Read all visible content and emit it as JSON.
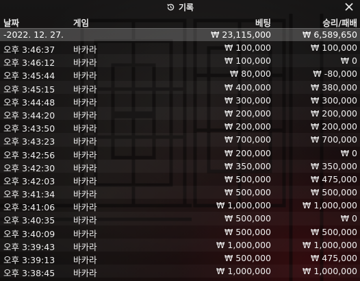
{
  "window": {
    "title": "기록",
    "icons": {
      "history": "clock-history-icon",
      "close": "close-icon"
    }
  },
  "columns": {
    "date": "날짜",
    "game": "게임",
    "bet": "베팅",
    "result": "승리/패배"
  },
  "summary": {
    "date": "-2022. 12. 27.",
    "game": "",
    "bet": "₩ 23,115,000",
    "result": "₩ 6,589,650"
  },
  "rows": [
    {
      "time": "오후 3:46:37",
      "game": "바카라",
      "bet": "₩ 100,000",
      "result": "₩ 100,000"
    },
    {
      "time": "오후 3:46:12",
      "game": "바카라",
      "bet": "₩ 100,000",
      "result": "₩ 0"
    },
    {
      "time": "오후 3:45:44",
      "game": "바카라",
      "bet": "₩ 80,000",
      "result": "₩ -80,000"
    },
    {
      "time": "오후 3:45:15",
      "game": "바카라",
      "bet": "₩ 400,000",
      "result": "₩ 380,000"
    },
    {
      "time": "오후 3:44:48",
      "game": "바카라",
      "bet": "₩ 300,000",
      "result": "₩ 300,000"
    },
    {
      "time": "오후 3:44:20",
      "game": "바카라",
      "bet": "₩ 200,000",
      "result": "₩ 200,000"
    },
    {
      "time": "오후 3:43:50",
      "game": "바카라",
      "bet": "₩ 200,000",
      "result": "₩ 200,000"
    },
    {
      "time": "오후 3:43:23",
      "game": "바카라",
      "bet": "₩ 700,000",
      "result": "₩ 700,000"
    },
    {
      "time": "오후 3:42:56",
      "game": "바카라",
      "bet": "₩ 200,000",
      "result": "₩ 0"
    },
    {
      "time": "오후 3:42:30",
      "game": "바카라",
      "bet": "₩ 350,000",
      "result": "₩ 350,000"
    },
    {
      "time": "오후 3:42:03",
      "game": "바카라",
      "bet": "₩ 500,000",
      "result": "₩ 475,000"
    },
    {
      "time": "오후 3:41:34",
      "game": "바카라",
      "bet": "₩ 500,000",
      "result": "₩ 500,000"
    },
    {
      "time": "오후 3:41:06",
      "game": "바카라",
      "bet": "₩ 1,000,000",
      "result": "₩ 1,000,000"
    },
    {
      "time": "오후 3:40:35",
      "game": "바카라",
      "bet": "₩ 500,000",
      "result": "₩ 0"
    },
    {
      "time": "오후 3:40:09",
      "game": "바카라",
      "bet": "₩ 500,000",
      "result": "₩ 500,000"
    },
    {
      "time": "오후 3:39:43",
      "game": "바카라",
      "bet": "₩ 1,000,000",
      "result": "₩ 1,000,000"
    },
    {
      "time": "오후 3:39:13",
      "game": "바카라",
      "bet": "₩ 500,000",
      "result": "₩ 475,000"
    },
    {
      "time": "오후 3:38:45",
      "game": "바카라",
      "bet": "₩ 1,000,000",
      "result": "₩ 1,000,000"
    }
  ]
}
